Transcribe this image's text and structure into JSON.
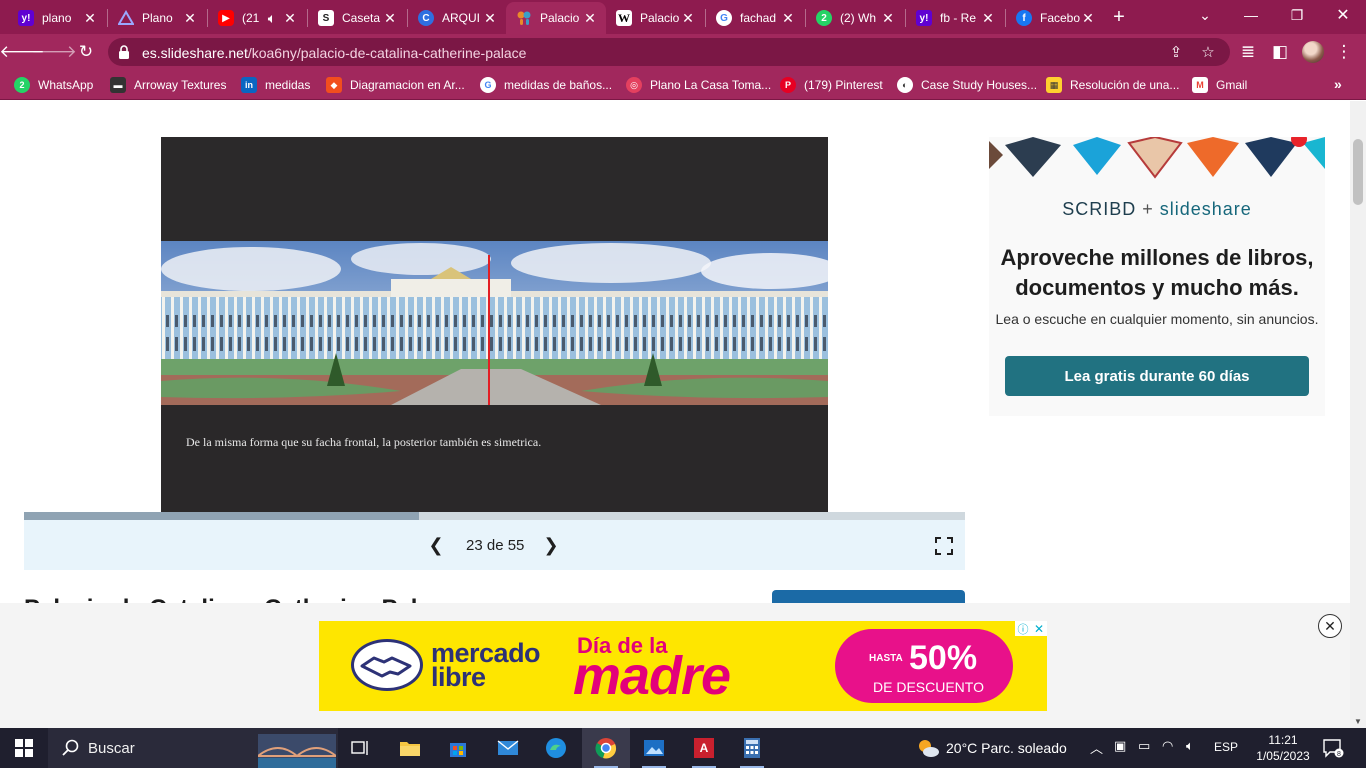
{
  "browser": {
    "tabs": [
      {
        "label": "plano",
        "icon": "yahoo-icon",
        "color": "#6001d2"
      },
      {
        "label": "Plano",
        "icon": "archdaily-icon",
        "color": "#3b3b6b"
      },
      {
        "label": "(21",
        "icon": "youtube-icon",
        "color": "#ff0000"
      },
      {
        "label": "Caseta",
        "icon": "scribd-icon",
        "color": "#222222"
      },
      {
        "label": "ARQUI",
        "icon": "canva-icon",
        "color": "#2f6fe0"
      },
      {
        "label": "Palacio",
        "icon": "slideshare-icon",
        "color": "#e8e8e8"
      },
      {
        "label": "Palacio",
        "icon": "wikipedia-icon",
        "color": "#ffffff"
      },
      {
        "label": "fachad",
        "icon": "google-icon",
        "color": "#ffffff"
      },
      {
        "label": "(2) Wh",
        "icon": "whatsapp-icon",
        "color": "#25d366"
      },
      {
        "label": "fb - Re",
        "icon": "yahoo-icon",
        "color": "#6001d2"
      },
      {
        "label": "Facebo",
        "icon": "facebook-icon",
        "color": "#1877f2"
      }
    ],
    "url_host": "es.slideshare.net",
    "url_path": "/koa6ny/palacio-de-catalina-catherine-palace",
    "bookmarks": [
      {
        "label": "WhatsApp",
        "icon": "whatsapp-icon",
        "color": "#25d366"
      },
      {
        "label": "Arroway Textures",
        "icon": "arroway-icon",
        "color": "#333333"
      },
      {
        "label": "medidas",
        "icon": "linkedin-icon",
        "color": "#0a66c2"
      },
      {
        "label": "Diagramacion en Ar...",
        "icon": "figma-icon",
        "color": "#f24e1e"
      },
      {
        "label": "medidas de baños...",
        "icon": "google-icon",
        "color": "#ffffff"
      },
      {
        "label": "Plano La Casa Toma...",
        "icon": "target-icon",
        "color": "#e4405f"
      },
      {
        "label": "(179) Pinterest",
        "icon": "pinterest-icon",
        "color": "#e60023"
      },
      {
        "label": "Case Study Houses...",
        "icon": "globe-icon",
        "color": "#ffffff"
      },
      {
        "label": "Resolución de una...",
        "icon": "miro-icon",
        "color": "#ffd02f"
      },
      {
        "label": "Gmail",
        "icon": "gmail-icon",
        "color": "#ea4335"
      }
    ]
  },
  "slide": {
    "caption": "De la misma forma que su facha frontal, la posterior también es simetrica.",
    "counter": "23 de 55",
    "current": 23,
    "total": 55,
    "progress_fraction": 0.42
  },
  "document": {
    "title": "Palacio de Catalina - Catherine Palace"
  },
  "promo": {
    "brand_scribd": "SCRIBD",
    "brand_plus": "+",
    "brand_slideshare": "slideshare",
    "headline": "Aproveche millones de libros, documentos y mucho más.",
    "subtext": "Lea o escuche en cualquier momento, sin anuncios.",
    "cta": "Lea gratis durante 60 días"
  },
  "ad": {
    "brand_line1": "mercado",
    "brand_line2": "libre",
    "dia": "Día de la",
    "madre": "madre",
    "hasta": "HASTA",
    "percent": "50%",
    "descuento": "DE DESCUENTO",
    "info": "ⓘ",
    "close": "✕"
  },
  "taskbar": {
    "search_text": "Buscar",
    "weather": "20°C  Parc. soleado",
    "lang": "ESP",
    "time": "11:21",
    "date": "1/05/2023",
    "notification_count": "8"
  },
  "colors": {
    "browser_frame": "#8e1b4f",
    "toolbar": "#a1285d",
    "promo_cta": "#217281",
    "ad_yellow": "#fee600",
    "ad_magenta": "#e3007b"
  }
}
